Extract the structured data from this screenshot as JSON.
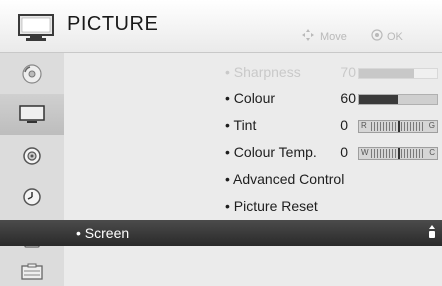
{
  "header": {
    "title": "PICTURE",
    "hint_move": "Move",
    "hint_ok": "OK"
  },
  "sidebar": {
    "items": [
      {
        "icon": "disc-icon"
      },
      {
        "icon": "tv-icon",
        "active": true
      },
      {
        "icon": "speaker-icon"
      },
      {
        "icon": "clock-icon"
      },
      {
        "icon": "lock-icon"
      },
      {
        "icon": "option-icon"
      }
    ]
  },
  "menu": {
    "sharpness": {
      "label": "• Sharpness",
      "value": "70",
      "level_pct": 70
    },
    "colour": {
      "label": "• Colour",
      "value": "60",
      "level_pct": 50
    },
    "tint": {
      "label": "• Tint",
      "value": "0",
      "left": "R",
      "right": "G"
    },
    "colour_temp": {
      "label": "• Colour Temp.",
      "value": "0",
      "left": "W",
      "right": "C"
    },
    "advanced": {
      "label": "• Advanced Control"
    },
    "reset": {
      "label": "• Picture Reset"
    },
    "screen": {
      "label": "• Screen"
    }
  },
  "colors": {
    "selected_bg": "#333333",
    "header_bg": "#f4f4f4",
    "sidebar_bg": "#dcdcdc"
  }
}
